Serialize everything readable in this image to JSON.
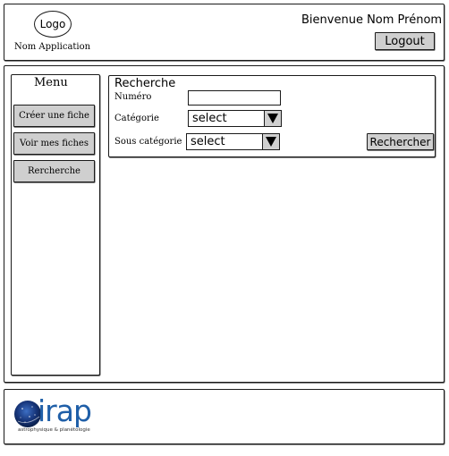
{
  "header": {
    "logo_text": "Logo",
    "app_name": "Nom Application",
    "welcome": "Bienvenue Nom Prénom",
    "logout_label": "Logout"
  },
  "menu": {
    "title": "Menu",
    "items": [
      {
        "label": "Créer une fiche"
      },
      {
        "label": "Voir mes fiches"
      },
      {
        "label": "Rercherche"
      }
    ]
  },
  "search": {
    "title": "Recherche",
    "numero_label": "Numéro",
    "numero_value": "",
    "categorie_label": "Catégorie",
    "categorie_value": "select",
    "sous_categorie_label": "Sous catégorie",
    "sous_categorie_value": "select",
    "submit_label": "Rechercher"
  },
  "footer": {
    "logo_text": "irap",
    "logo_tagline": "astrophysique & planétologie",
    "colors": {
      "brand": "#1f5fa8",
      "orb_dark": "#0a1f4a"
    }
  }
}
